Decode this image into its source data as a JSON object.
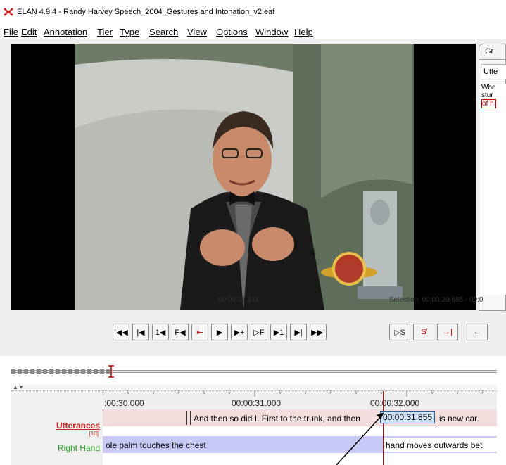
{
  "window": {
    "title": "ELAN 4.9.4 - Randy Harvey Speech_2004_Gestures and Intonation_v2.eaf"
  },
  "menu": [
    "File",
    "Edit",
    "Annotation",
    "Tier",
    "Type",
    "Search",
    "View",
    "Options",
    "Window",
    "Help"
  ],
  "right_panel": {
    "tab": "Gr",
    "header": "Utte",
    "lines": [
      "Whe",
      "stur"
    ],
    "highlight": "of h"
  },
  "player": {
    "current_time": "00:00:31.911",
    "selection": "Selection: 00:00:29.685 - 00:0"
  },
  "controls": [
    {
      "name": "go-to-begin-button",
      "label": "|◀◀"
    },
    {
      "name": "previous-frame-button",
      "label": "|◀"
    },
    {
      "name": "previous-second-button",
      "label": "1◀"
    },
    {
      "name": "previous-annotation-button",
      "label": "F◀"
    },
    {
      "name": "previous-selection-boundary-button",
      "label": "⇤"
    },
    {
      "name": "play-button",
      "label": "▶"
    },
    {
      "name": "play-selection-button",
      "label": "▶+"
    },
    {
      "name": "next-annotation-button",
      "label": "▷F"
    },
    {
      "name": "next-second-button",
      "label": "▶1"
    },
    {
      "name": "next-frame-button",
      "label": "▶|"
    },
    {
      "name": "go-to-end-button",
      "label": "▶▶|"
    }
  ],
  "selection_controls": [
    {
      "name": "play-selection-s-button",
      "label": "▷S"
    },
    {
      "name": "clear-selection-button",
      "label": "S̸"
    },
    {
      "name": "selection-mode-button",
      "label": "→|"
    },
    {
      "name": "back-arrow-button",
      "label": "←"
    }
  ],
  "timeline": {
    "ticks": [
      ":00:30.000",
      "00:00:31.000",
      "00:00:32.000"
    ],
    "tiers": [
      {
        "name": "Utterances",
        "count": "[10]",
        "color": "#cc2222",
        "annotations": [
          "And then so did I. First to the trunk, and then",
          "is new car."
        ]
      },
      {
        "name": "Right Hand",
        "count": "",
        "color": "#22a022",
        "annotations": [
          "ole palm touches the chest",
          "hand moves outwards bet"
        ]
      }
    ],
    "crosshair_time": "00:00:31.855"
  },
  "colors": {
    "tier1_band": "#f3dede",
    "tier2_band": "#c9c9f5",
    "crosshair": "#cc0000",
    "accent": "#2a5fa8"
  }
}
